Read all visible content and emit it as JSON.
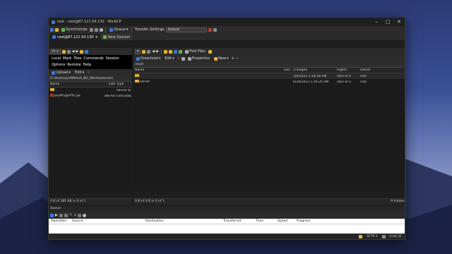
{
  "window": {
    "title": "root - root@87.121.54.130 - WinSCP"
  },
  "toolbar1": {
    "synchronize": "Synchronize",
    "queue": "Queue",
    "transfer_settings": "Transfer Settings",
    "transfer_value": "Default"
  },
  "tabs": [
    {
      "label": "root@87.121.54.130"
    },
    {
      "label": "New Session"
    }
  ],
  "left": {
    "menu_items": [
      "Local",
      "Mark",
      "Files",
      "Commands",
      "Session",
      "Options",
      "Remote",
      "Help"
    ],
    "upload": "Upload",
    "edit": "Edit",
    "path": "D:\\Desktop\\AMIHost_BG_Work\\tutorials\\",
    "columns": [
      "Name",
      "Size",
      "Type"
    ],
    "files": [
      {
        "name": "..",
        "size": "",
        "type": "Parent di"
      },
      {
        "name": "JavaPluginFile.jar",
        "size": "386 KB",
        "type": "Executab"
      }
    ],
    "status": "0 B of 385 KB in 0 of 1"
  },
  "right": {
    "download": "Download",
    "edit": "Edit",
    "properties": "Properties",
    "new": "New",
    "find_files": "Find Files",
    "path": "/root/",
    "columns": [
      "Name",
      "Size",
      "Changed",
      "Rights",
      "Owner"
    ],
    "files": [
      {
        "name": "..",
        "size": "",
        "changed": "3/9/2022 3:18:28 AM",
        "rights": "rwxr-xr-x",
        "owner": "root"
      },
      {
        "name": "server",
        "size": "",
        "changed": "6/28/2023 1:29:26 AM",
        "rights": "rwxr-xr-x",
        "owner": "root"
      }
    ],
    "status": "0 B of 0 B in 0 of 1",
    "hidden": "9 hidden"
  },
  "queue": {
    "title": "Queue",
    "columns": [
      "Operation",
      "Source",
      "Destination",
      "Transferred",
      "Time",
      "Speed",
      "Progress"
    ]
  },
  "statusbar": {
    "protocol": "SFTP-3",
    "time": "0:00:31"
  },
  "colors": {
    "bg": "#1e1e1e",
    "folder": "#e2b33a",
    "accent": "#3a78d8"
  }
}
